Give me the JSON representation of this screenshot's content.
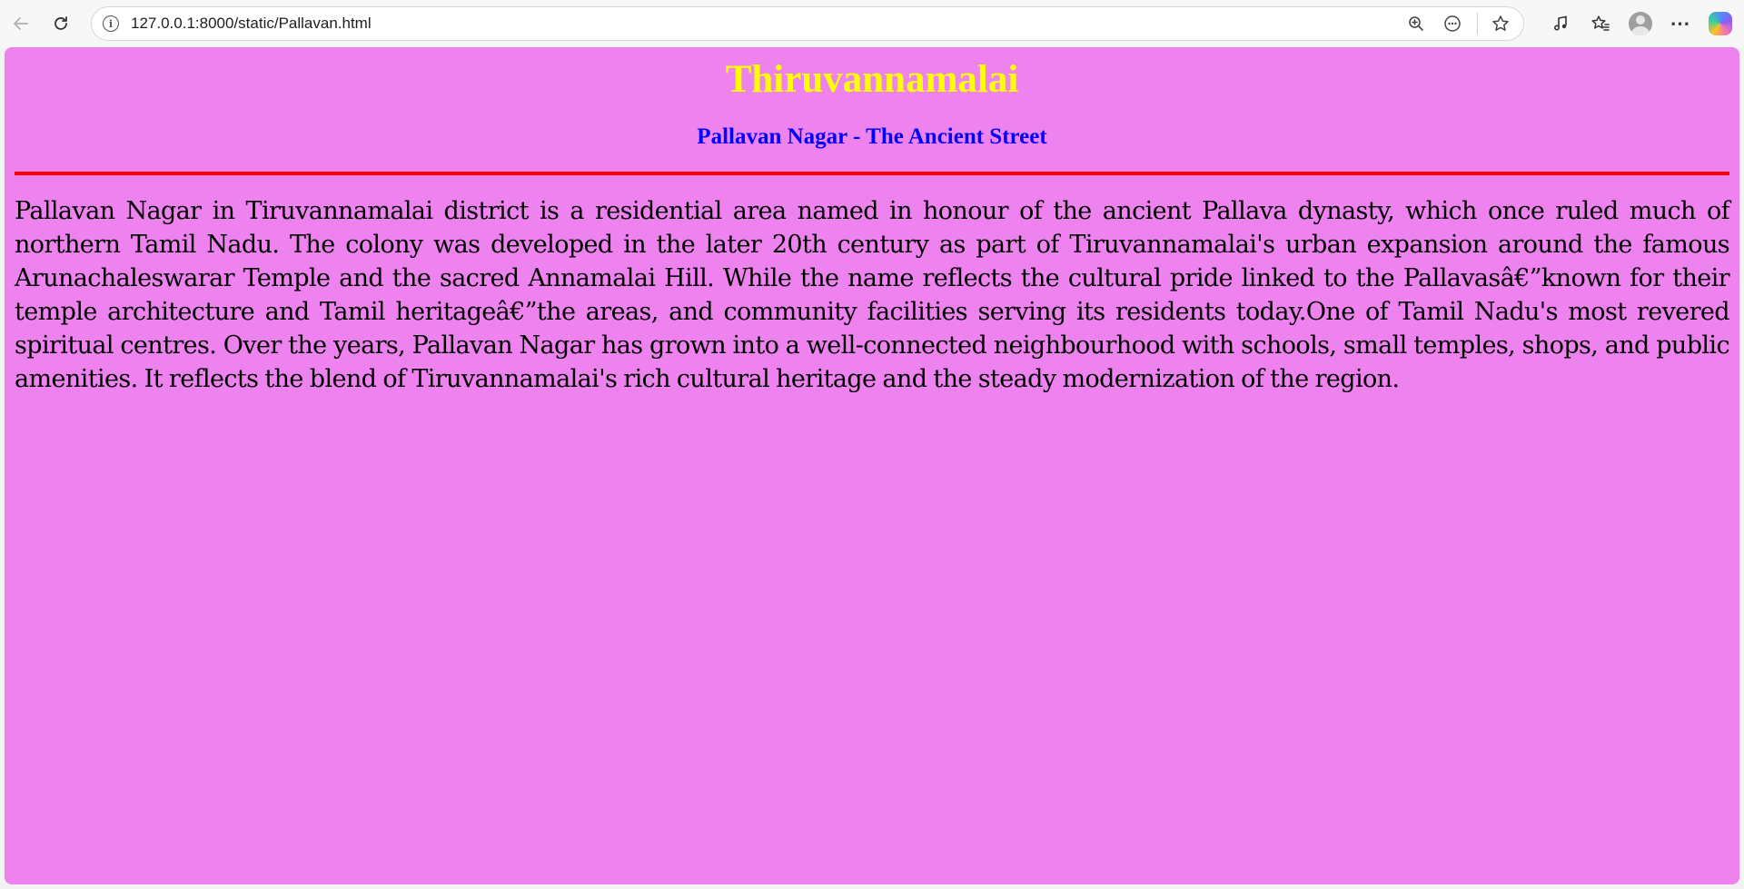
{
  "browser": {
    "url": "127.0.0.1:8000/static/Pallavan.html",
    "icons": {
      "back": "back-arrow-icon",
      "reload": "reload-icon",
      "site_info": "info-icon",
      "zoom": "zoom-icon",
      "extensions_menu": "more-circle-icon",
      "favorite": "star-icon",
      "media": "music-note-icon",
      "favorites": "favorites-list-icon",
      "profile": "avatar-icon",
      "settings": "ellipsis-icon",
      "copilot": "copilot-icon"
    }
  },
  "page": {
    "title": "Thiruvannamalai",
    "subtitle": "Pallavan Nagar - The Ancient Street",
    "paragraph": "Pallavan Nagar in Tiruvannamalai district is a residential area named in honour of the ancient Pallava dynasty, which once ruled much of northern Tamil Nadu. The colony was developed in the later 20th century as part of Tiruvannamalai's urban expansion around the famous Arunachaleswarar Temple and the sacred Annamalai Hill. While the name reflects the cultural pride linked to the Pallavasâ€”known for their temple architecture and Tamil heritageâ€”the areas, and community facilities serving its residents today.One of Tamil Nadu's most revered spiritual centres. Over the years, Pallavan Nagar has grown into a well-connected neighbourhood with schools, small temples, shops, and public amenities. It reflects the blend of Tiruvannamalai's rich cultural heritage and the steady modernization of the region."
  },
  "colors": {
    "page_background": "#ee82ee",
    "title": "#ffff00",
    "subtitle": "#0000ff",
    "divider": "#ff0000",
    "text": "#000000"
  }
}
